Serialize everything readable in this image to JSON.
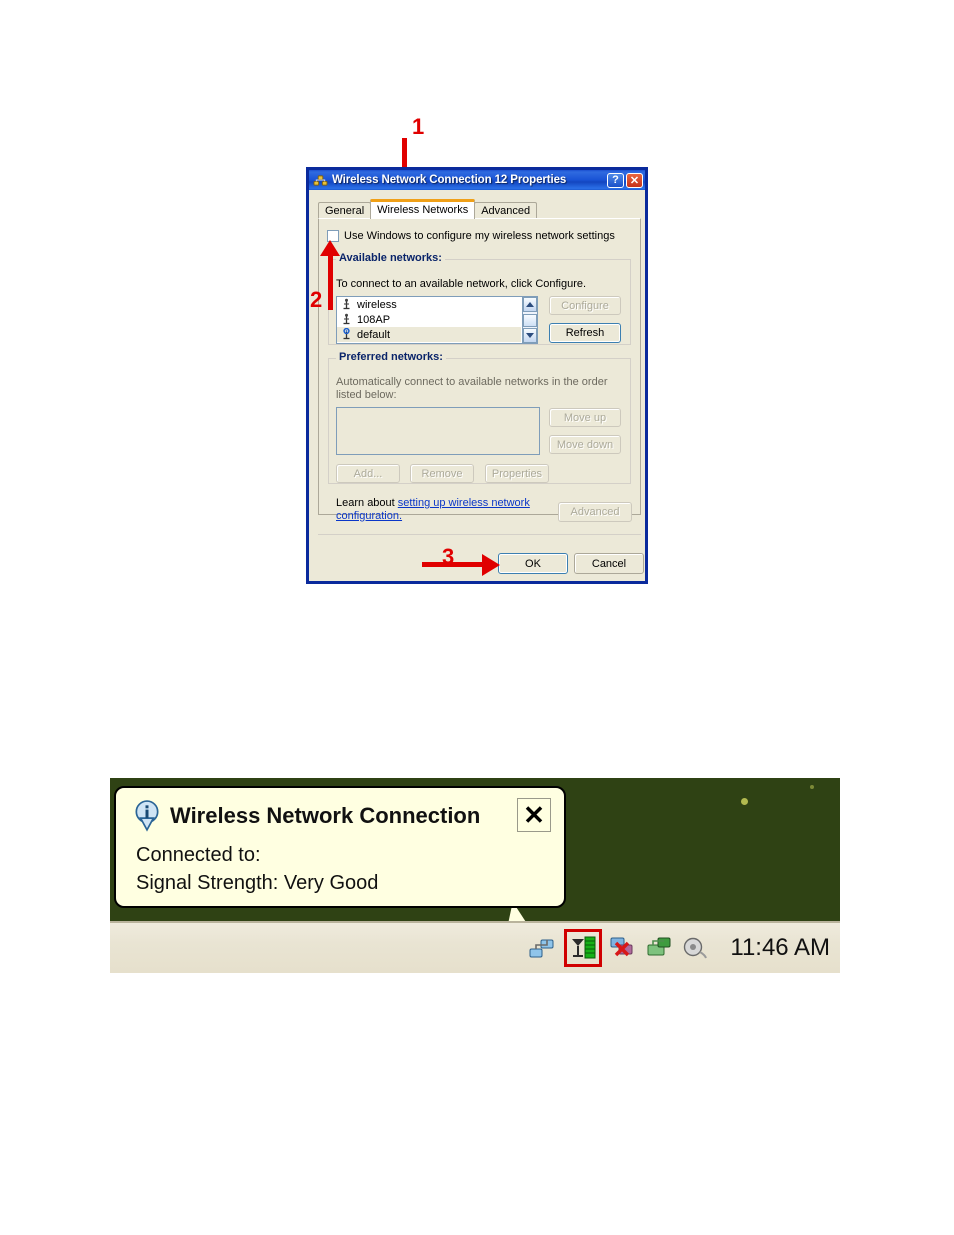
{
  "annotations": [
    {
      "id": "1",
      "label": "1",
      "target": "wireless-networks-tab"
    },
    {
      "id": "2",
      "label": "2",
      "target": "use-windows-checkbox"
    },
    {
      "id": "3",
      "label": "3",
      "target": "ok-button"
    }
  ],
  "dialog": {
    "title": "Wireless Network Connection 12 Properties",
    "title_icon": "network-connection-icon",
    "help_button": "?",
    "close_button": "✕",
    "tabs": [
      {
        "label": "General",
        "active": false
      },
      {
        "label": "Wireless Networks",
        "active": true
      },
      {
        "label": "Advanced",
        "active": false
      }
    ],
    "use_windows_checkbox": {
      "label": "Use Windows to configure my wireless network settings",
      "checked": false
    },
    "available_networks": {
      "group_title": "Available networks:",
      "hint": "To connect to an available network, click Configure.",
      "items": [
        {
          "name": "wireless",
          "icon": "access-point-icon",
          "selected": false
        },
        {
          "name": "108AP",
          "icon": "access-point-icon",
          "selected": false
        },
        {
          "name": "default",
          "icon": "access-point-active-icon",
          "selected": true
        }
      ],
      "configure_button": {
        "label": "Configure",
        "enabled": false
      },
      "refresh_button": {
        "label": "Refresh",
        "enabled": true
      }
    },
    "preferred_networks": {
      "group_title": "Preferred networks:",
      "hint": "Automatically connect to available networks in the order listed below:",
      "items": [],
      "move_up_button": {
        "label": "Move up",
        "enabled": false
      },
      "move_down_button": {
        "label": "Move down",
        "enabled": false
      },
      "add_button": {
        "label": "Add...",
        "enabled": false
      },
      "remove_button": {
        "label": "Remove",
        "enabled": false
      },
      "properties_button": {
        "label": "Properties",
        "enabled": false
      }
    },
    "learn_more": {
      "prefix": "Learn about ",
      "link_text": "setting up wireless network configuration.",
      "advanced_button": {
        "label": "Advanced",
        "enabled": false
      }
    },
    "ok_button": {
      "label": "OK",
      "focused": true
    },
    "cancel_button": {
      "label": "Cancel",
      "focused": false
    }
  },
  "notification": {
    "icon": "info-icon",
    "title": "Wireless Network Connection",
    "close_label": "✕",
    "lines": [
      "Connected to:",
      "Signal Strength: Very Good"
    ]
  },
  "taskbar": {
    "tray_icons": [
      {
        "name": "network-connection-tray-icon",
        "highlighted": false
      },
      {
        "name": "wireless-signal-tray-icon",
        "highlighted": true
      },
      {
        "name": "network-disconnected-tray-icon",
        "highlighted": false
      },
      {
        "name": "safely-remove-hardware-tray-icon",
        "highlighted": false
      },
      {
        "name": "volume-tray-icon",
        "highlighted": false
      }
    ],
    "clock": "11:46 AM"
  },
  "colors": {
    "annotation_red": "#e00000",
    "dialog_border_blue": "#0a2a9c",
    "titlebar_blue": "#1a54d6",
    "tab_accent_orange": "#f0a017",
    "group_title_blue": "#0a246a",
    "link_blue": "#0a36c8",
    "face": "#ece9d8",
    "desktop_green": "#2f4214",
    "balloon_bg": "#ffffe1"
  }
}
